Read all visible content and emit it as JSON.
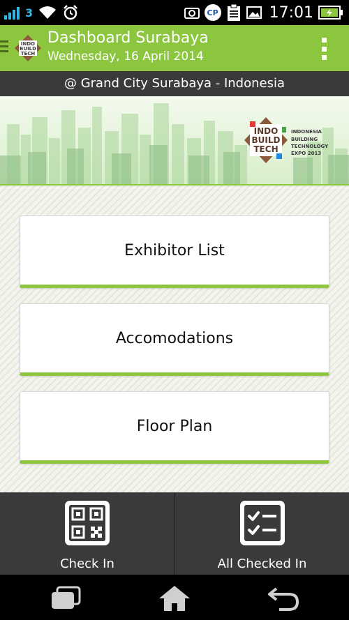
{
  "status_bar": {
    "network": "3",
    "time": "17:01",
    "cp_label": "CP"
  },
  "action_bar": {
    "title": "Dashboard Surabaya",
    "subtitle": "Wednesday, 16 April 2014",
    "logo_text": [
      "INDO",
      "BUILD",
      "TECH"
    ],
    "background": "#8cc63f"
  },
  "location": {
    "text": "@ Grand City Surabaya - Indonesia"
  },
  "banner": {
    "logo_text": [
      "INDO",
      "BUILD",
      "TECH"
    ],
    "tagline": [
      "INDONESIA",
      "BUILDING",
      "TECHNOLOGY",
      "EXPO 2013"
    ]
  },
  "menu": {
    "items": [
      {
        "label": "Exhibitor List"
      },
      {
        "label": "Accomodations"
      },
      {
        "label": "Floor Plan"
      }
    ]
  },
  "bottom_tabs": [
    {
      "label": "Check In",
      "icon": "qr-code-icon"
    },
    {
      "label": "All Checked In",
      "icon": "checklist-icon"
    }
  ],
  "nav_bar": {
    "buttons": [
      "recent-apps-icon",
      "home-icon",
      "back-icon"
    ]
  },
  "colors": {
    "accent_green": "#8cc63f",
    "dark_bar": "#3a3a3a",
    "logo_brown": "#8b5a3c"
  }
}
